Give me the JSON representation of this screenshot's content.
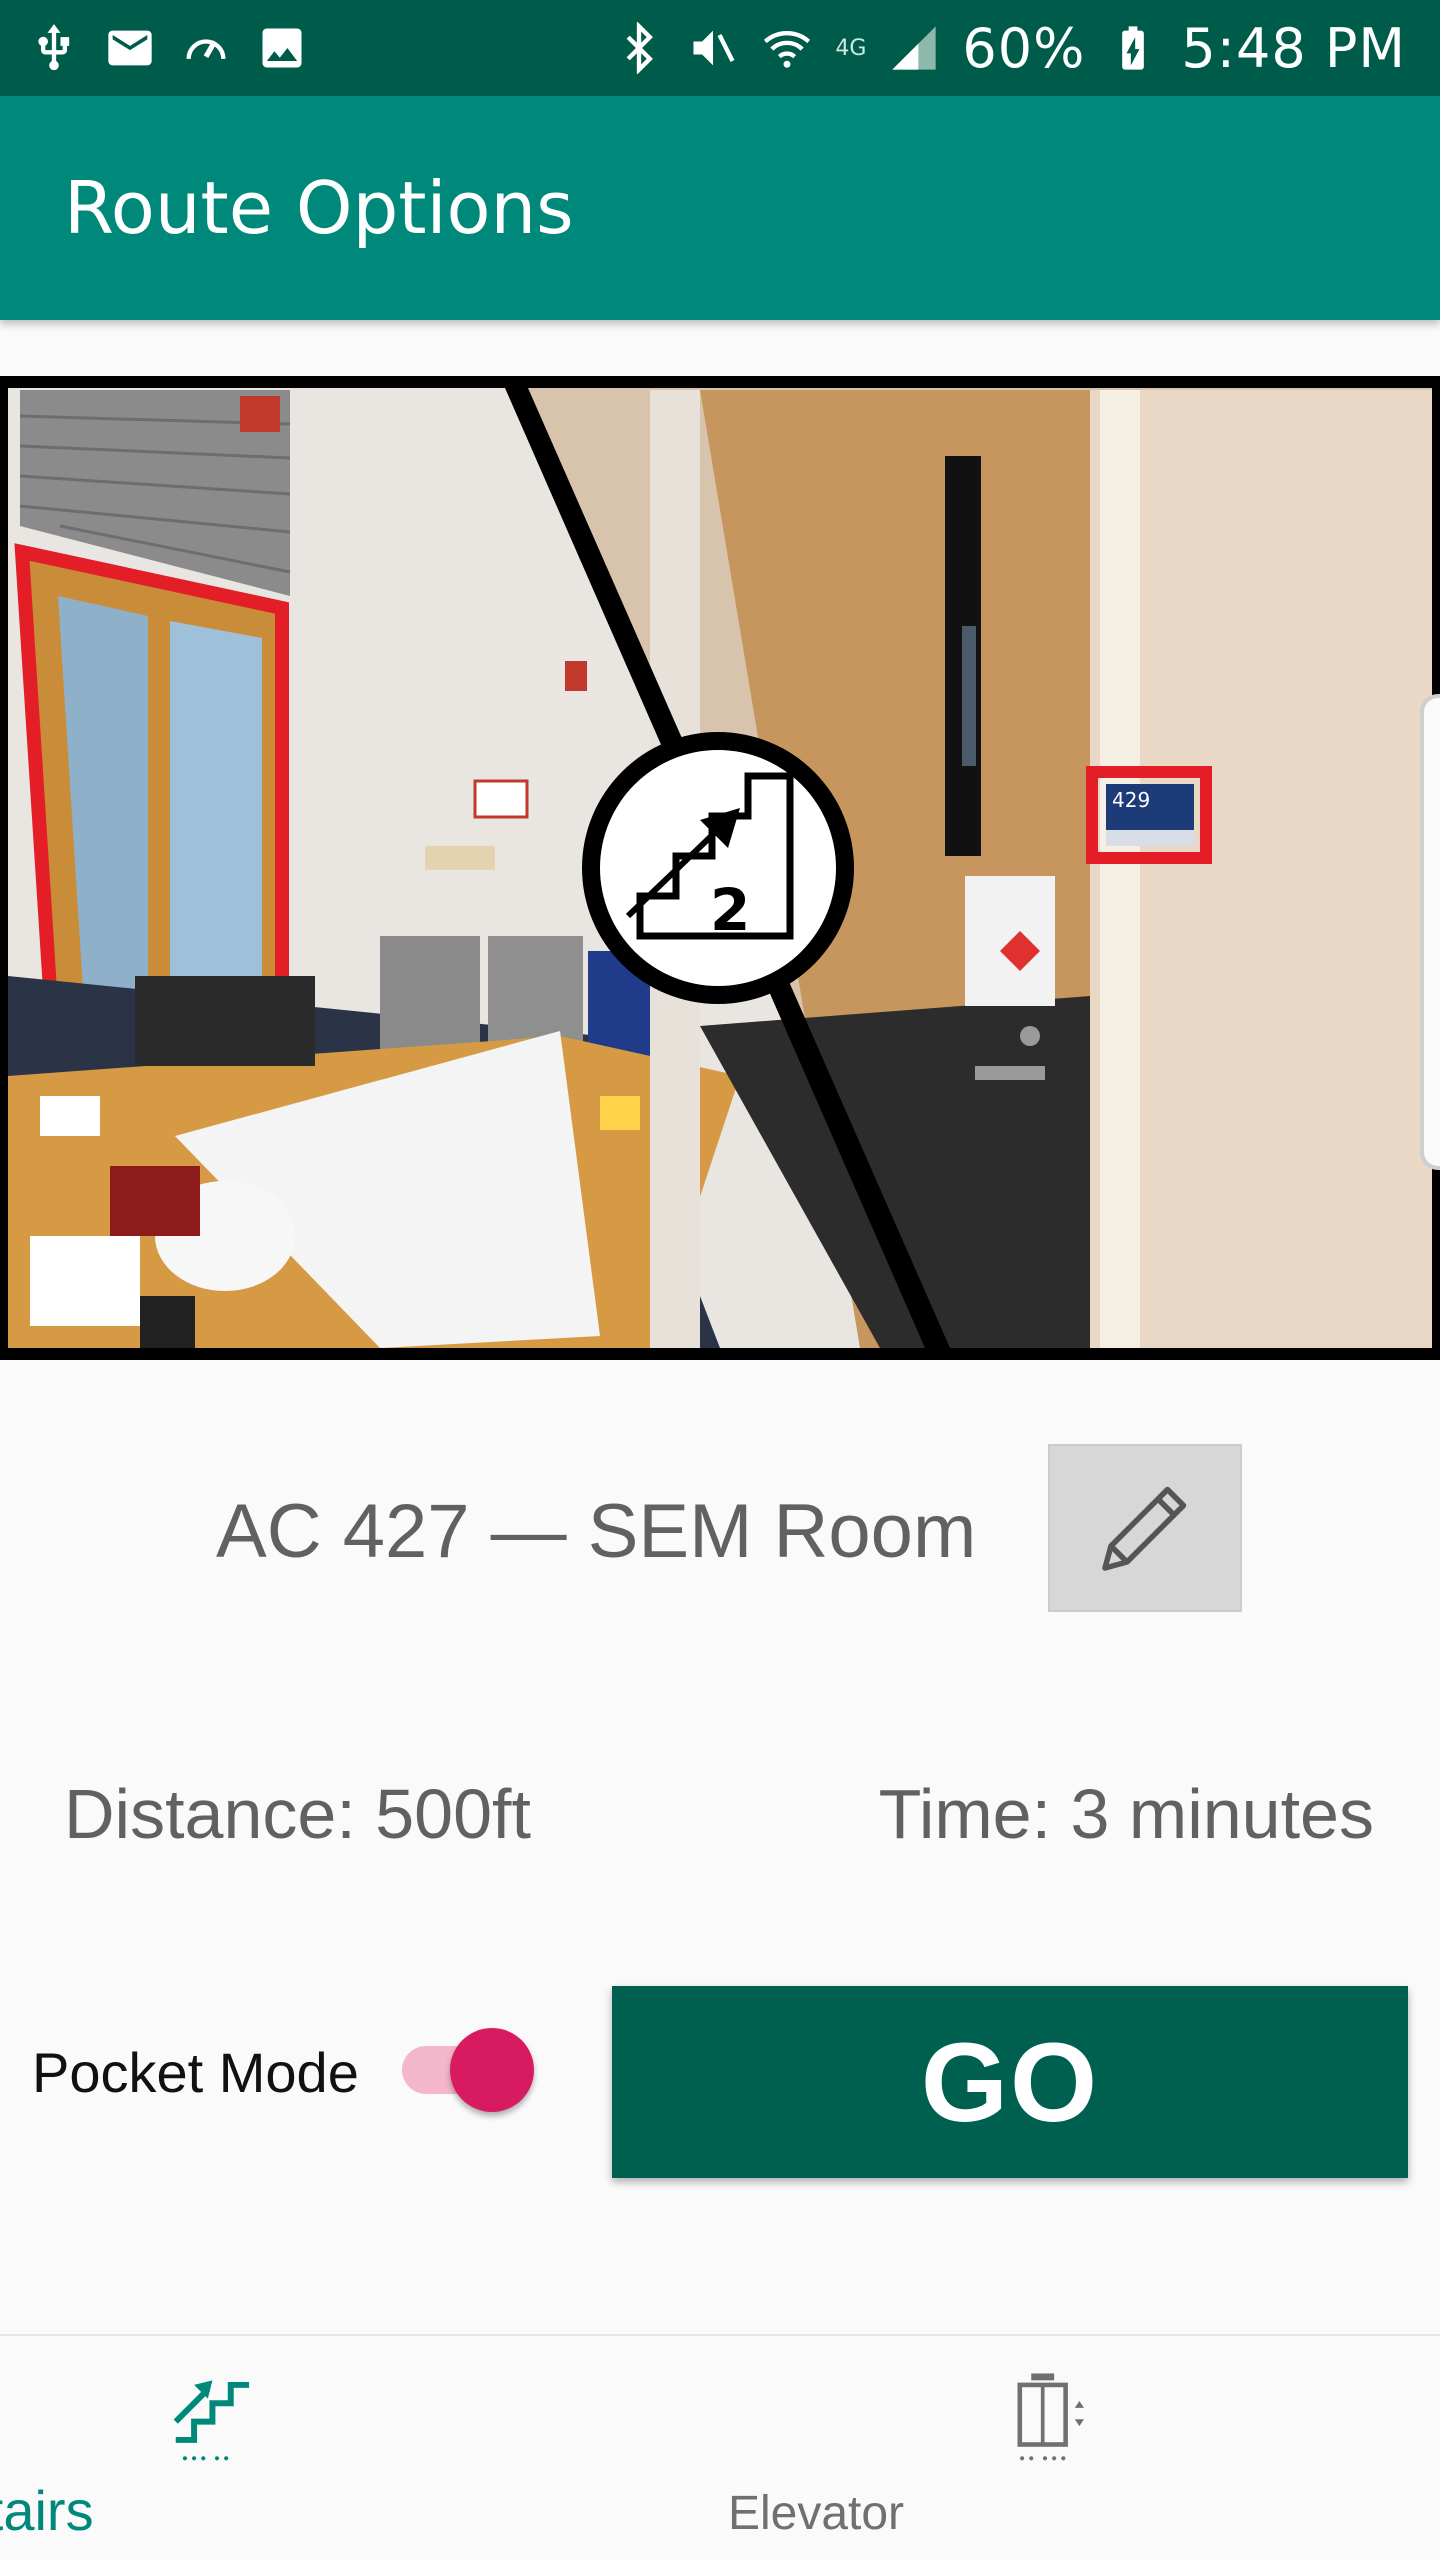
{
  "status_bar": {
    "battery_percent": "60%",
    "time": "5:48 PM",
    "network_label": "4G",
    "left_icons": [
      "usb-icon",
      "mail-icon",
      "speed-icon",
      "image-icon"
    ],
    "right_icons": [
      "bluetooth-icon",
      "mute-vibrate-icon",
      "wifi-icon",
      "network-4g-icon",
      "signal-icon",
      "battery-charging-icon"
    ]
  },
  "app_bar": {
    "title": "Route Options"
  },
  "hero": {
    "room_sign_number": "429",
    "floor_badge_number": "2"
  },
  "destination": {
    "label": "AC 427 — SEM Room"
  },
  "stats": {
    "distance": "Distance: 500ft",
    "time": "Time: 3 minutes"
  },
  "pocket_mode": {
    "label": "Pocket Mode",
    "enabled": true
  },
  "go_button": {
    "label": "GO"
  },
  "bottom_nav": {
    "items": [
      {
        "label": "Stairs",
        "icon": "stairs-icon",
        "selected": true
      },
      {
        "label": "Elevator",
        "icon": "elevator-icon",
        "selected": false
      }
    ]
  },
  "colors": {
    "status_bar": "#005c4a",
    "app_bar": "#00897b",
    "go_button": "#00604f",
    "switch_thumb": "#d81b60",
    "switch_track": "#f3b6ca",
    "nav_selected": "#00897b",
    "nav_unselected": "#707070"
  }
}
